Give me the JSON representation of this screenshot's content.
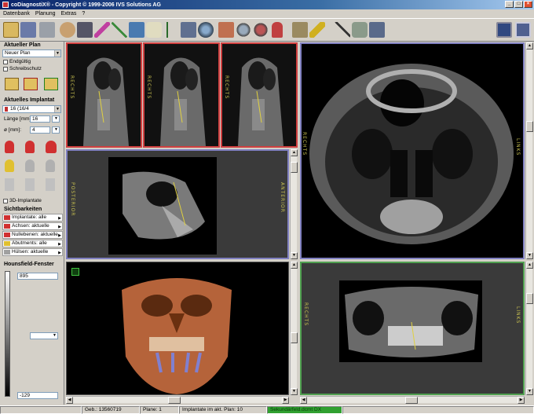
{
  "window": {
    "title": "coDiagnostiX® - Copyright © 1999-2006 IVS Solutions AG"
  },
  "menu": {
    "items": [
      "Datenbank",
      "Planung",
      "Extras",
      "?"
    ]
  },
  "sidebar": {
    "plan_title": "Aktueller Plan",
    "plan_value": "Neuer Plan",
    "endgueltig": "Endgültig",
    "schreibschutz": "Schreibschutz",
    "implant_title": "Aktuelles Implantat",
    "implant_value": "16 (16/4",
    "laenge_label": "Länge [mm]:",
    "laenge_value": "16",
    "durchmesser_label": "ø [mm]:",
    "durchmesser_value": "4",
    "implant3d_label": "3D-Implantate",
    "visibility_title": "Sichtbarkeiten",
    "visibility_rows": [
      "Implantate: alle",
      "Achsen: aktuelle",
      "Nullebenen: aktuelle",
      "Abutments: alle",
      "Hülsen: aktuelle"
    ],
    "hounsfield_title": "Hounsfield-Fenster",
    "hf_top_value": "895",
    "hf_bottom_value": "-129"
  },
  "viewports": {
    "label_rechts": "RECHTS",
    "label_links": "LINKS",
    "label_posterior": "POSTERIOR",
    "label_anterior": "ANTERIOR"
  },
  "status": {
    "geb": "Geb.: 13560719",
    "plane": "Plane: 1",
    "implants": "Implantate im akt. Plan: 10",
    "progress": "Sekundärfeld.dcmt DX"
  },
  "colors": {
    "title_gradient_start": "#0a246a",
    "frame_red": "#d04040",
    "frame_blue": "#8080c0",
    "frame_green": "#50a050",
    "progress_green": "#30a030",
    "bone_3d": "#b5633a"
  }
}
